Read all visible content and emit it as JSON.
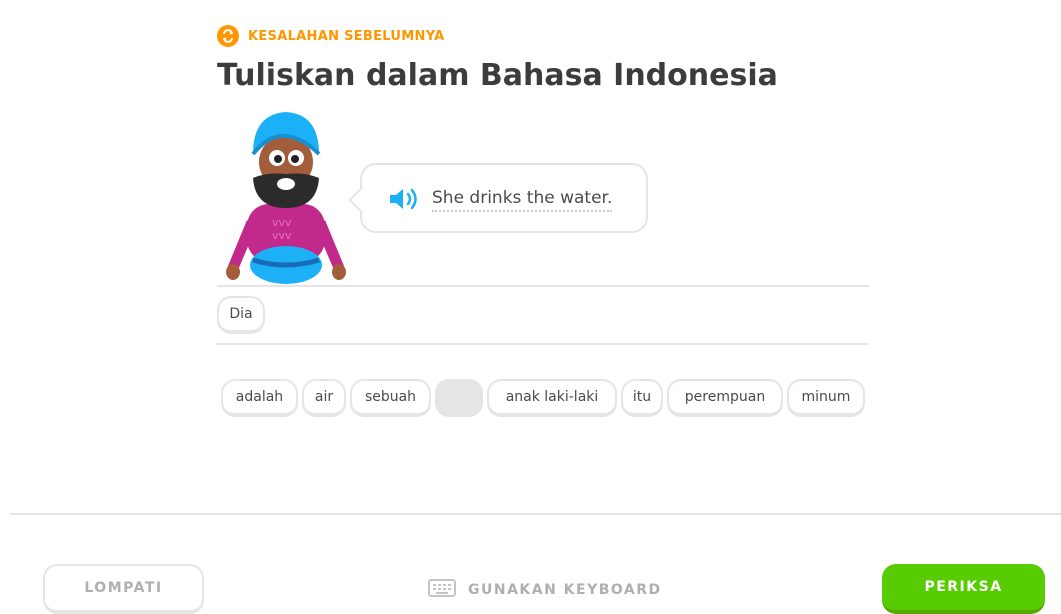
{
  "header": {
    "badge_label": "KESALAHAN SEBELUMNYA",
    "badge_icon": "repeat-icon",
    "title": "Tuliskan dalam Bahasa Indonesia"
  },
  "prompt": {
    "speaker_icon": "speaker-icon",
    "sentence": "She drinks the water."
  },
  "answer": {
    "tiles": [
      "Dia"
    ]
  },
  "word_bank": {
    "tiles": [
      "adalah",
      "air",
      "sebuah",
      "",
      "anak laki-laki",
      "itu",
      "perempuan",
      "minum"
    ],
    "used_index": 3
  },
  "footer": {
    "skip_label": "LOMPATI",
    "keyboard_label": "GUNAKAN KEYBOARD",
    "keyboard_icon": "keyboard-icon",
    "check_label": "PERIKSA"
  },
  "colors": {
    "accent_orange": "#ff9600",
    "check_green": "#58cc02",
    "tile_border": "#e5e5e5"
  }
}
